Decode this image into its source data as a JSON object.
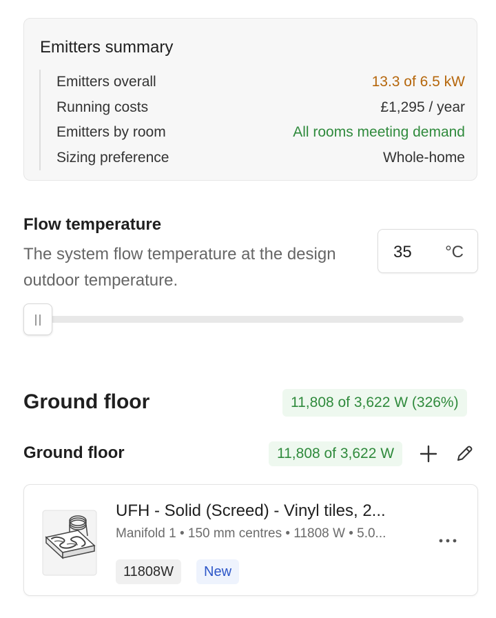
{
  "summary": {
    "title": "Emitters summary",
    "rows": [
      {
        "label": "Emitters overall",
        "value": "13.3 of 6.5 kW"
      },
      {
        "label": "Running costs",
        "value": "£1,295 / year"
      },
      {
        "label": "Emitters by room",
        "value": "All rooms meeting demand"
      },
      {
        "label": "Sizing preference",
        "value": "Whole-home"
      }
    ]
  },
  "flow": {
    "title": "Flow temperature",
    "description": "The system flow temperature at the design outdoor temperature.",
    "value": "35",
    "unit": "°C",
    "slider_level": 0
  },
  "floor": {
    "title": "Ground floor",
    "badge": "11,808 of 3,622 W (326%)"
  },
  "room": {
    "title": "Ground floor",
    "badge": "11,808 of 3,622 W",
    "emitter": {
      "title": "UFH - Solid (Screed) - Vinyl tiles, 2...",
      "subtitle": "Manifold 1 • 150 mm centres • 11808 W • 5.0...",
      "power_tag": "11808W",
      "status_tag": "New"
    }
  },
  "colors": {
    "warning": "#b5660b",
    "success": "#2f8a3c",
    "success_bg": "#eef8ef",
    "new_tag": "#2c56c8"
  }
}
